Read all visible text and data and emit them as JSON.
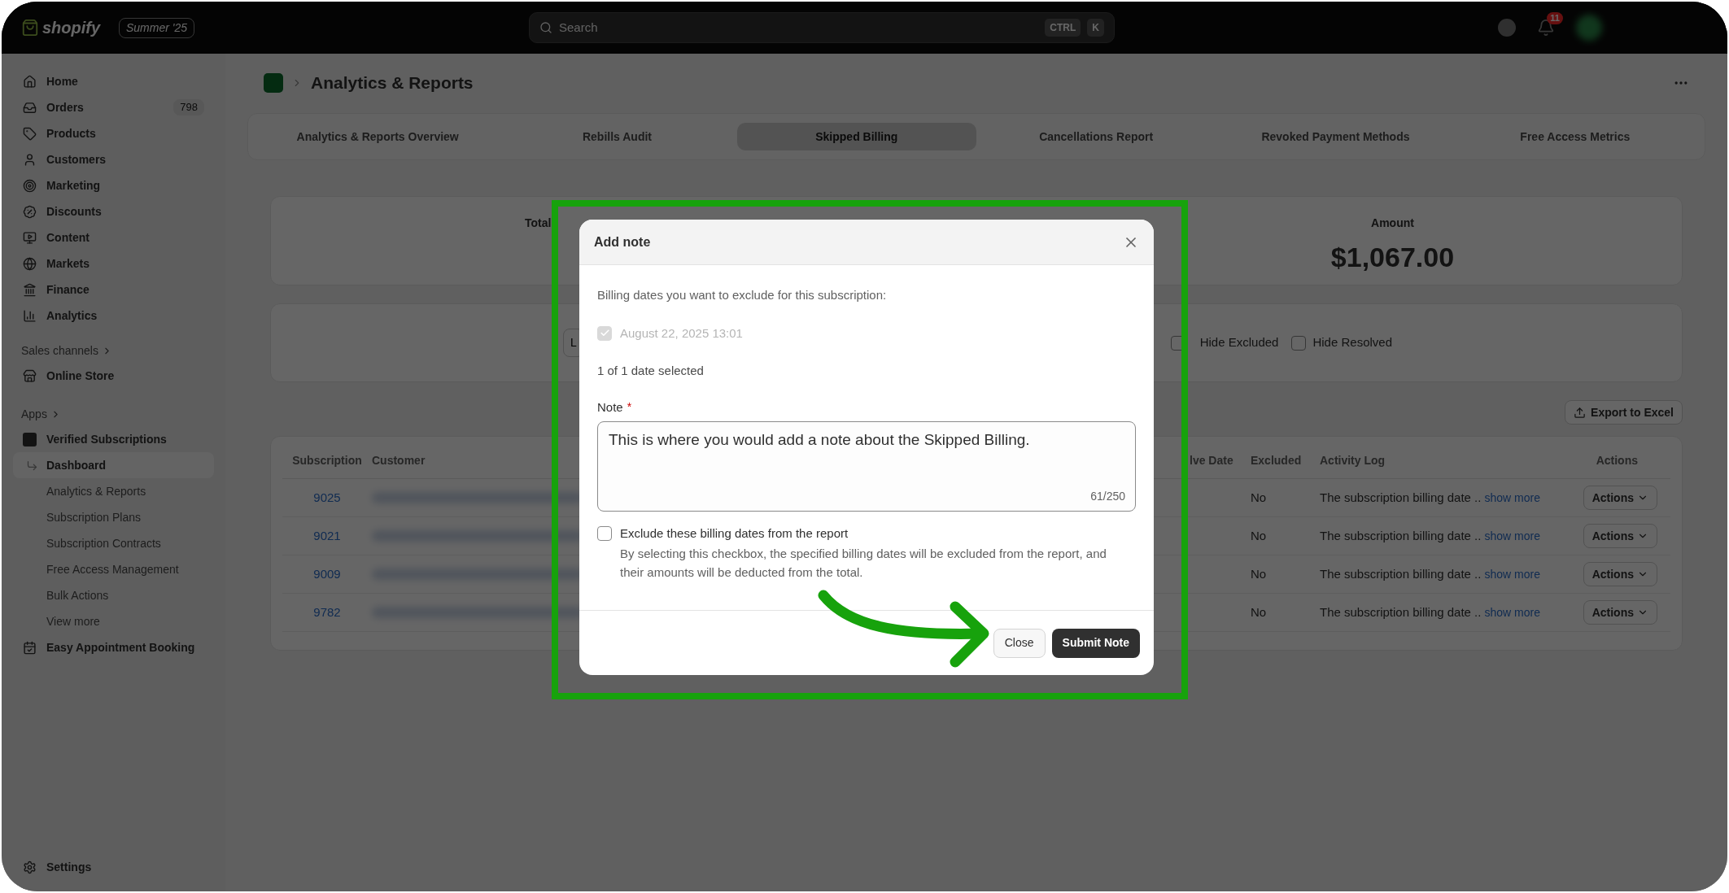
{
  "topbar": {
    "logo": "shopify",
    "edition": "Summer '25",
    "search": {
      "placeholder": "Search"
    },
    "shortcut": [
      "CTRL",
      "K"
    ],
    "notification_count": "11"
  },
  "sidebar": {
    "items": [
      {
        "label": "Home"
      },
      {
        "label": "Orders",
        "count": "798"
      },
      {
        "label": "Products"
      },
      {
        "label": "Customers"
      },
      {
        "label": "Marketing"
      },
      {
        "label": "Discounts"
      },
      {
        "label": "Content"
      },
      {
        "label": "Markets"
      },
      {
        "label": "Finance"
      },
      {
        "label": "Analytics"
      }
    ],
    "sales_channels": {
      "heading": "Sales channels",
      "items": [
        {
          "label": "Online Store"
        }
      ]
    },
    "apps": {
      "heading": "Apps",
      "items": [
        {
          "label": "Verified Subscriptions",
          "children": [
            {
              "label": "Dashboard",
              "selected": true
            },
            {
              "label": "Analytics & Reports",
              "selected": false
            },
            {
              "label": "Subscription Plans",
              "selected": false
            },
            {
              "label": "Subscription Contracts",
              "selected": false
            },
            {
              "label": "Free Access Management",
              "selected": false
            },
            {
              "label": "Bulk Actions",
              "selected": false
            },
            {
              "label": "View more",
              "selected": false
            }
          ]
        },
        {
          "label": "Easy Appointment Booking"
        }
      ]
    },
    "footer": {
      "label": "Settings"
    }
  },
  "page": {
    "title": "Analytics & Reports",
    "tabs": [
      {
        "label": "Analytics & Reports Overview",
        "selected": false
      },
      {
        "label": "Rebills Audit",
        "selected": false
      },
      {
        "label": "Skipped Billing",
        "selected": true
      },
      {
        "label": "Cancellations Report",
        "selected": false
      },
      {
        "label": "Revoked Payment Methods",
        "selected": false
      },
      {
        "label": "Free Access Metrics",
        "selected": false
      }
    ],
    "stats": [
      {
        "label": "Total"
      },
      {
        "label": "Amount",
        "value": "$1,067.00"
      }
    ],
    "filters": {
      "button_fragment": "L",
      "checkboxes": [
        {
          "label": "Hide Excluded",
          "checked": false
        },
        {
          "label": "Hide Resolved",
          "checked": false
        }
      ]
    },
    "export_button": "Export to Excel",
    "table": {
      "columns": [
        "Subscription",
        "Customer",
        "lve Date",
        "Excluded",
        "Activity Log",
        "Actions"
      ],
      "rows": [
        {
          "subscription": "9025",
          "excluded": "No",
          "activity": "The subscription billing date ..",
          "link": "show more",
          "action": "Actions"
        },
        {
          "subscription": "9021",
          "excluded": "No",
          "activity": "The subscription billing date ..",
          "link": "show more",
          "action": "Actions"
        },
        {
          "subscription": "9009",
          "excluded": "No",
          "activity": "The subscription billing date ..",
          "link": "show more",
          "action": "Actions"
        },
        {
          "subscription": "9782",
          "excluded": "No",
          "activity": "The subscription billing date ..",
          "link": "show more",
          "action": "Actions"
        }
      ]
    }
  },
  "modal": {
    "title": "Add note",
    "prompt": "Billing dates you want to exclude for this subscription:",
    "dates": [
      {
        "label": "August 22, 2025 13:01",
        "checked": true,
        "disabled": true
      }
    ],
    "selection_count": "1 of 1 date selected",
    "note": {
      "label": "Note",
      "required": "*",
      "value": "This is where you would add a note about the Skipped Billing.",
      "counter": "61/250"
    },
    "exclude": {
      "label": "Exclude these billing dates from the report",
      "checked": false,
      "description": "By selecting this checkbox, the specified billing dates will be excluded from the report, and their amounts will be deducted from the total."
    },
    "buttons": [
      {
        "label": "Close",
        "kind": "secondary"
      },
      {
        "label": "Submit Note",
        "kind": "primary"
      }
    ]
  }
}
